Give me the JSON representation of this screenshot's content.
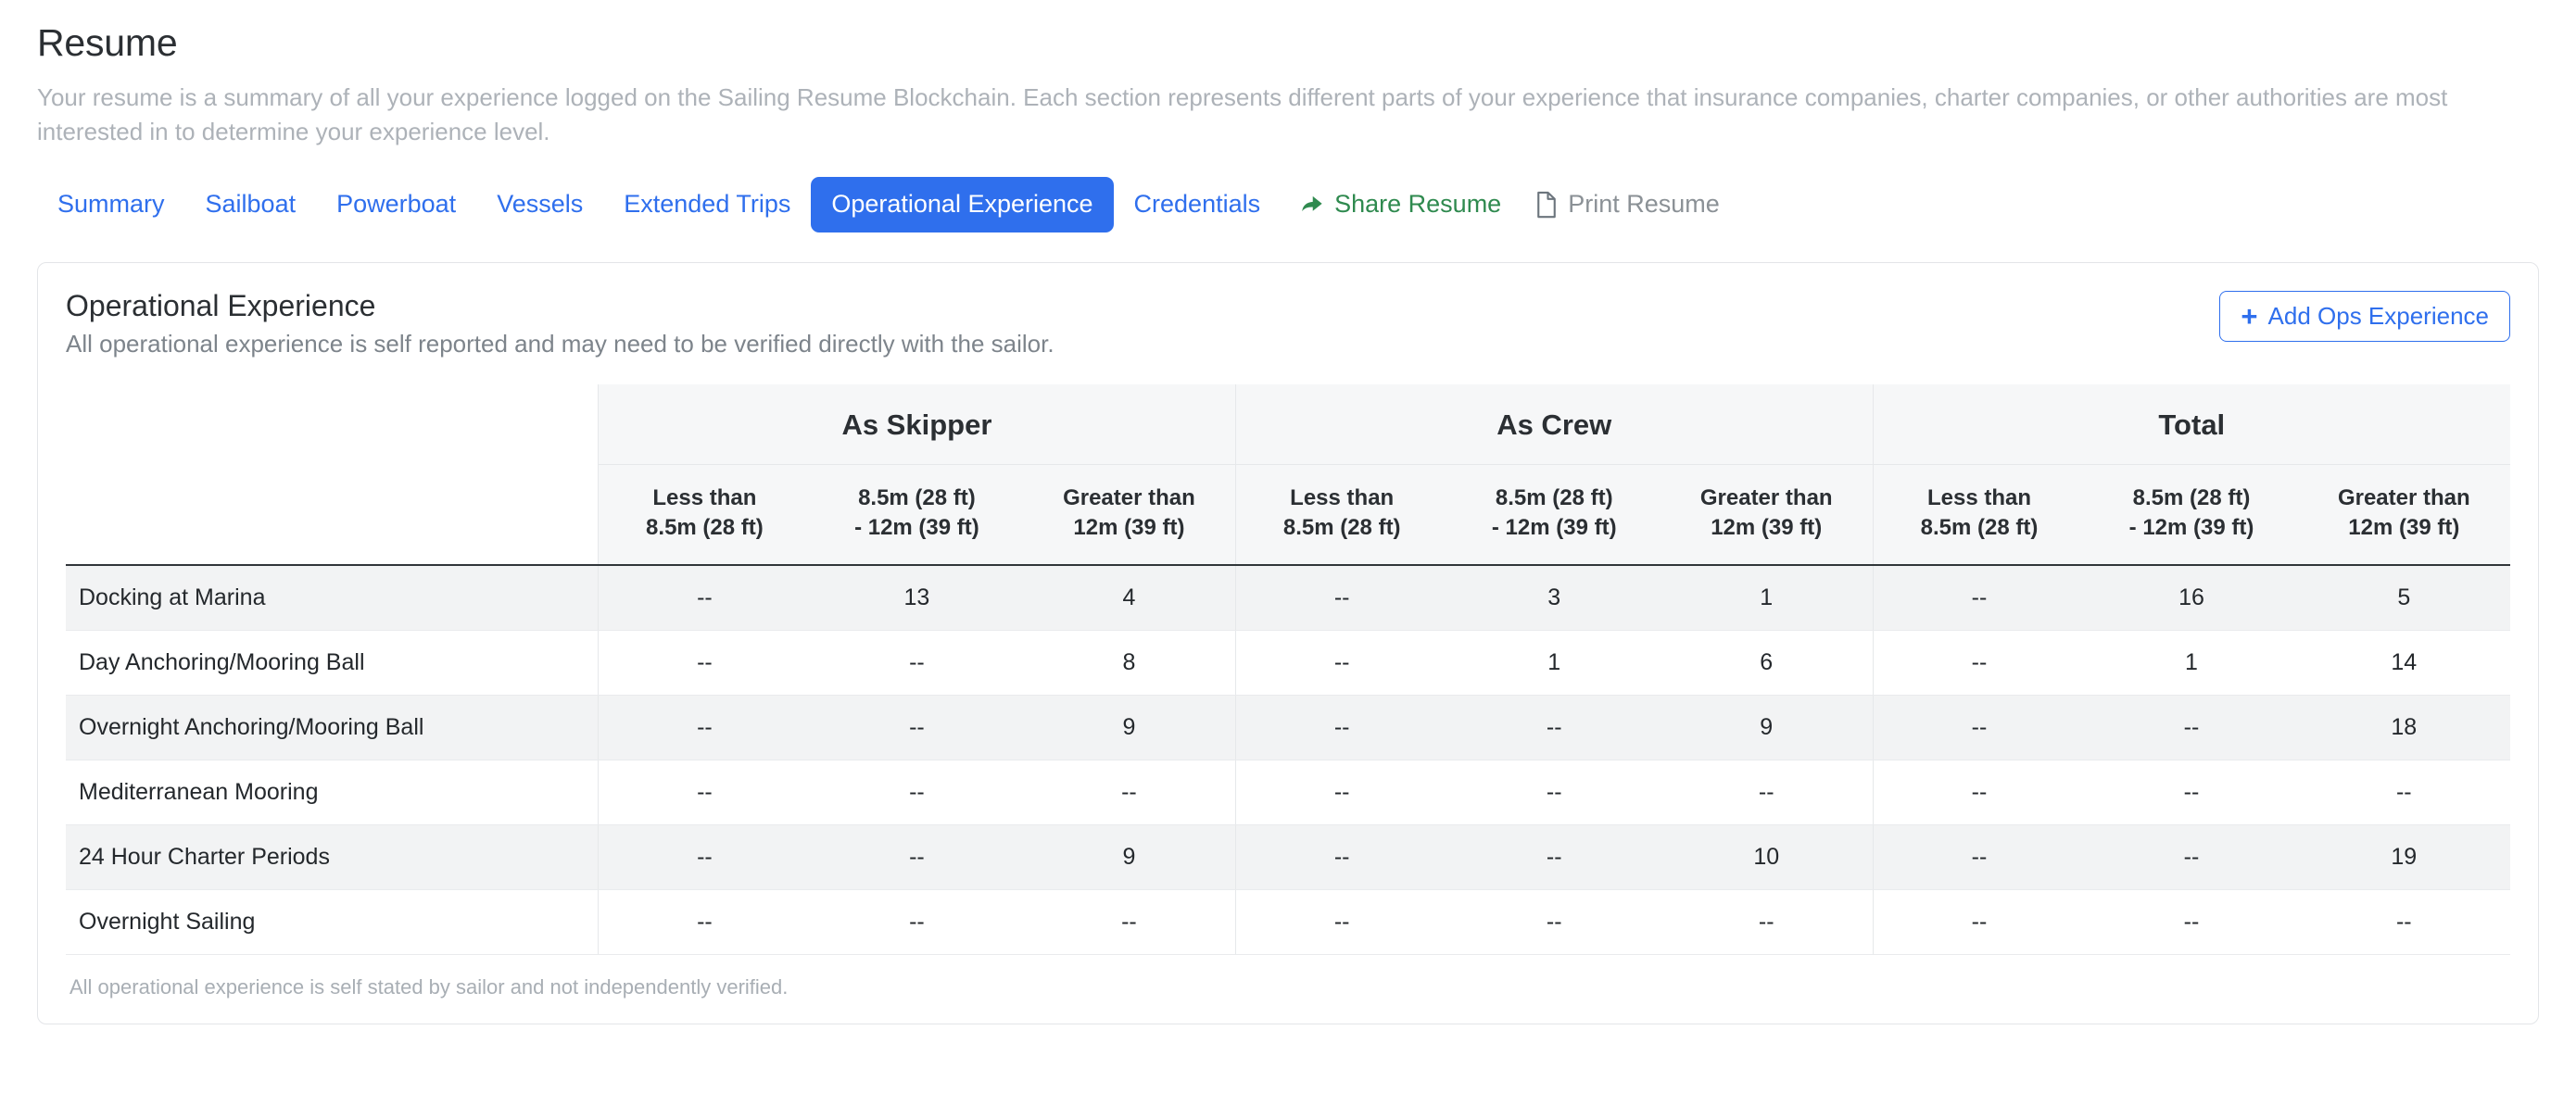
{
  "page": {
    "title": "Resume",
    "description": "Your resume is a summary of all your experience logged on the Sailing Resume Blockchain. Each section represents different parts of your experience that insurance companies, charter companies, or other authorities are most interested in to determine your experience level."
  },
  "tabs": [
    {
      "label": "Summary",
      "active": false
    },
    {
      "label": "Sailboat",
      "active": false
    },
    {
      "label": "Powerboat",
      "active": false
    },
    {
      "label": "Vessels",
      "active": false
    },
    {
      "label": "Extended Trips",
      "active": false
    },
    {
      "label": "Operational Experience",
      "active": true
    },
    {
      "label": "Credentials",
      "active": false
    }
  ],
  "tab_actions": {
    "share": {
      "label": "Share Resume",
      "icon": "share-arrow-icon",
      "color": "#2f8a4f"
    },
    "print": {
      "label": "Print Resume",
      "icon": "document-icon",
      "color": "#8b9196"
    }
  },
  "card": {
    "title": "Operational Experience",
    "subtitle": "All operational experience is self reported and may need to be verified directly with the sailor.",
    "add_button": {
      "label": "Add Ops Experience",
      "icon": "plus-icon"
    },
    "footnote": "All operational experience is self stated by sailor and not independently verified."
  },
  "chart_data": {
    "type": "table",
    "title": "Operational Experience",
    "group_headers": [
      "",
      "As Skipper",
      "As Crew",
      "Total"
    ],
    "sub_headers": [
      "Less than 8.5m (28 ft)",
      "8.5m (28 ft) - 12m (39 ft)",
      "Greater than 12m (39 ft)"
    ],
    "sub_headers_lines": [
      [
        "Less than",
        "8.5m (28 ft)"
      ],
      [
        "8.5m (28 ft)",
        "- 12m (39 ft)"
      ],
      [
        "Greater than",
        "12m (39 ft)"
      ]
    ],
    "empty_value": "--",
    "rows": [
      {
        "label": "Docking at Marina",
        "values": [
          "--",
          "13",
          "4",
          "--",
          "3",
          "1",
          "--",
          "16",
          "5"
        ]
      },
      {
        "label": "Day Anchoring/Mooring Ball",
        "values": [
          "--",
          "--",
          "8",
          "--",
          "1",
          "6",
          "--",
          "1",
          "14"
        ]
      },
      {
        "label": "Overnight Anchoring/Mooring Ball",
        "values": [
          "--",
          "--",
          "9",
          "--",
          "--",
          "9",
          "--",
          "--",
          "18"
        ]
      },
      {
        "label": "Mediterranean Mooring",
        "values": [
          "--",
          "--",
          "--",
          "--",
          "--",
          "--",
          "--",
          "--",
          "--"
        ]
      },
      {
        "label": "24 Hour Charter Periods",
        "values": [
          "--",
          "--",
          "9",
          "--",
          "--",
          "10",
          "--",
          "--",
          "19"
        ]
      },
      {
        "label": "Overnight Sailing",
        "values": [
          "--",
          "--",
          "--",
          "--",
          "--",
          "--",
          "--",
          "--",
          "--"
        ]
      }
    ]
  },
  "colors": {
    "accent": "#2f6fed",
    "share_green": "#2f8a4f",
    "print_gray": "#8b9196",
    "row_stripe": "#f2f3f4",
    "header_bg": "#f6f7f8"
  }
}
